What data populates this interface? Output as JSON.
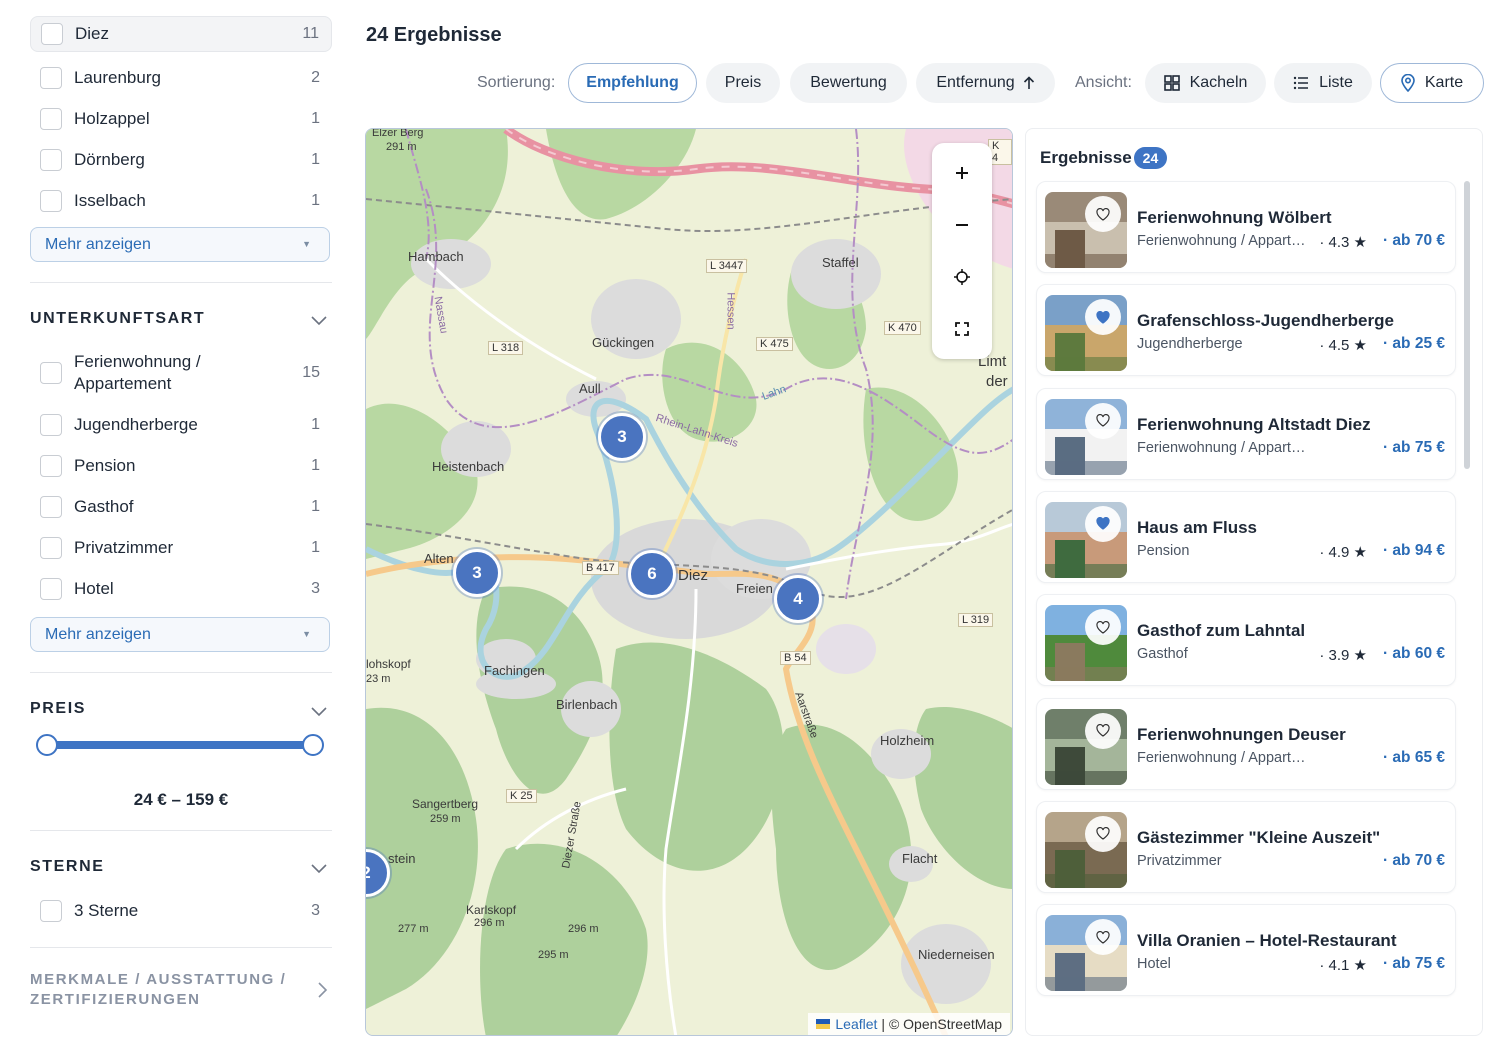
{
  "filters": {
    "ort": [
      {
        "label": "Diez",
        "count": "11",
        "active": true
      },
      {
        "label": "Laurenburg",
        "count": "2"
      },
      {
        "label": "Holzappel",
        "count": "1"
      },
      {
        "label": "Dörnberg",
        "count": "1"
      },
      {
        "label": "Isselbach",
        "count": "1"
      }
    ],
    "ort_more": "Mehr anzeigen",
    "unterkunftsart_title": "UNTERKUNFTSART",
    "unterkunftsart": [
      {
        "label": "Ferienwohnung / Appartement",
        "count": "15"
      },
      {
        "label": "Jugendherberge",
        "count": "1"
      },
      {
        "label": "Pension",
        "count": "1"
      },
      {
        "label": "Gasthof",
        "count": "1"
      },
      {
        "label": "Privatzimmer",
        "count": "1"
      },
      {
        "label": "Hotel",
        "count": "3"
      }
    ],
    "unterkunftsart_more": "Mehr anzeigen",
    "preis_title": "PREIS",
    "preis_range": "24 €  –  159 €",
    "sterne_title": "STERNE",
    "sterne": [
      {
        "label": "3 Sterne",
        "count": "3"
      }
    ],
    "merkmale_title": "MERKMALE / AUSSTATTUNG / ZERTIFIZIERUNGEN"
  },
  "header": {
    "result_count_title": "24 Ergebnisse",
    "sort_label": "Sortierung:",
    "sort_options": [
      "Empfehlung",
      "Preis",
      "Bewertung",
      "Entfernung"
    ],
    "sort_selected": "Empfehlung",
    "view_label": "Ansicht:",
    "view_options": [
      "Kacheln",
      "Liste",
      "Karte"
    ],
    "view_selected": "Karte"
  },
  "map": {
    "clusters": [
      "3",
      "3",
      "6",
      "4",
      "2"
    ],
    "place_labels": [
      "Elzer Berg",
      "291 m",
      "Hambach",
      "Staffel",
      "Gückingen",
      "Aull",
      "Heistenbach",
      "Diez",
      "Freien",
      "Alten",
      "Fachingen",
      "Birlenbach",
      "Holzheim",
      "Sangertberg",
      "259 m",
      "Karlskopf",
      "296 m",
      "296 m",
      "295 m",
      "277 m",
      "Flacht",
      "Niederneisen",
      "lohskopf",
      "23 m",
      "Limt",
      "der",
      "Rhein-Lahn-Kreis",
      "Lahn",
      "Nassau",
      "Hessen",
      "Diezer Straße",
      "Aarstraße",
      "stein"
    ],
    "road_labels": [
      "L 3447",
      "L 318",
      "K 475",
      "K 470",
      "B 417",
      "L 319",
      "B 54",
      "K 25",
      "K 4"
    ],
    "attribution_leaflet": "Leaflet",
    "attribution_rest": " | © OpenStreetMap"
  },
  "results": {
    "title": "Ergebnisse",
    "badge": "24",
    "items": [
      {
        "name": "Ferienwohnung Wölbert",
        "type": "Ferienwohnung / Appartement",
        "rating": "· 4.3 ★",
        "price": "· ab 70 €",
        "favorite": false
      },
      {
        "name": "Grafenschloss-Jugendherberge",
        "type": "Jugendherberge",
        "rating": "· 4.5 ★",
        "price": "· ab 25 €",
        "favorite": true
      },
      {
        "name": "Ferienwohnung Altstadt Diez",
        "type": "Ferienwohnung / Appartement",
        "rating": "",
        "price": "· ab 75 €",
        "favorite": false
      },
      {
        "name": "Haus am Fluss",
        "type": "Pension",
        "rating": "· 4.9 ★",
        "price": "· ab 94 €",
        "favorite": true
      },
      {
        "name": "Gasthof zum Lahntal",
        "type": "Gasthof",
        "rating": "· 3.9 ★",
        "price": "· ab 60 €",
        "favorite": false
      },
      {
        "name": "Ferienwohnungen Deuser",
        "type": "Ferienwohnung / Appartement",
        "rating": "",
        "price": "· ab 65 €",
        "favorite": false
      },
      {
        "name": "Gästezimmer \"Kleine Auszeit\"",
        "type": "Privatzimmer",
        "rating": "",
        "price": "· ab 70 €",
        "favorite": false
      },
      {
        "name": "Villa Oranien – Hotel-Restaurant",
        "type": "Hotel",
        "rating": "· 4.1 ★",
        "price": "· ab 75 €",
        "favorite": false
      }
    ]
  },
  "colors": {
    "accent": "#3e74c4",
    "link": "#2a6bb5",
    "map_forest": "#aed09c",
    "map_field": "#f1f2d8",
    "map_water": "#aad3df",
    "map_urban": "#e0e0e0"
  },
  "icons": [
    "chevron-down-icon",
    "chevron-right-icon",
    "grid-icon",
    "list-icon",
    "map-pin-icon",
    "arrow-up-icon",
    "zoom-in-icon",
    "zoom-out-icon",
    "locate-icon",
    "fullscreen-icon",
    "heart-icon"
  ]
}
